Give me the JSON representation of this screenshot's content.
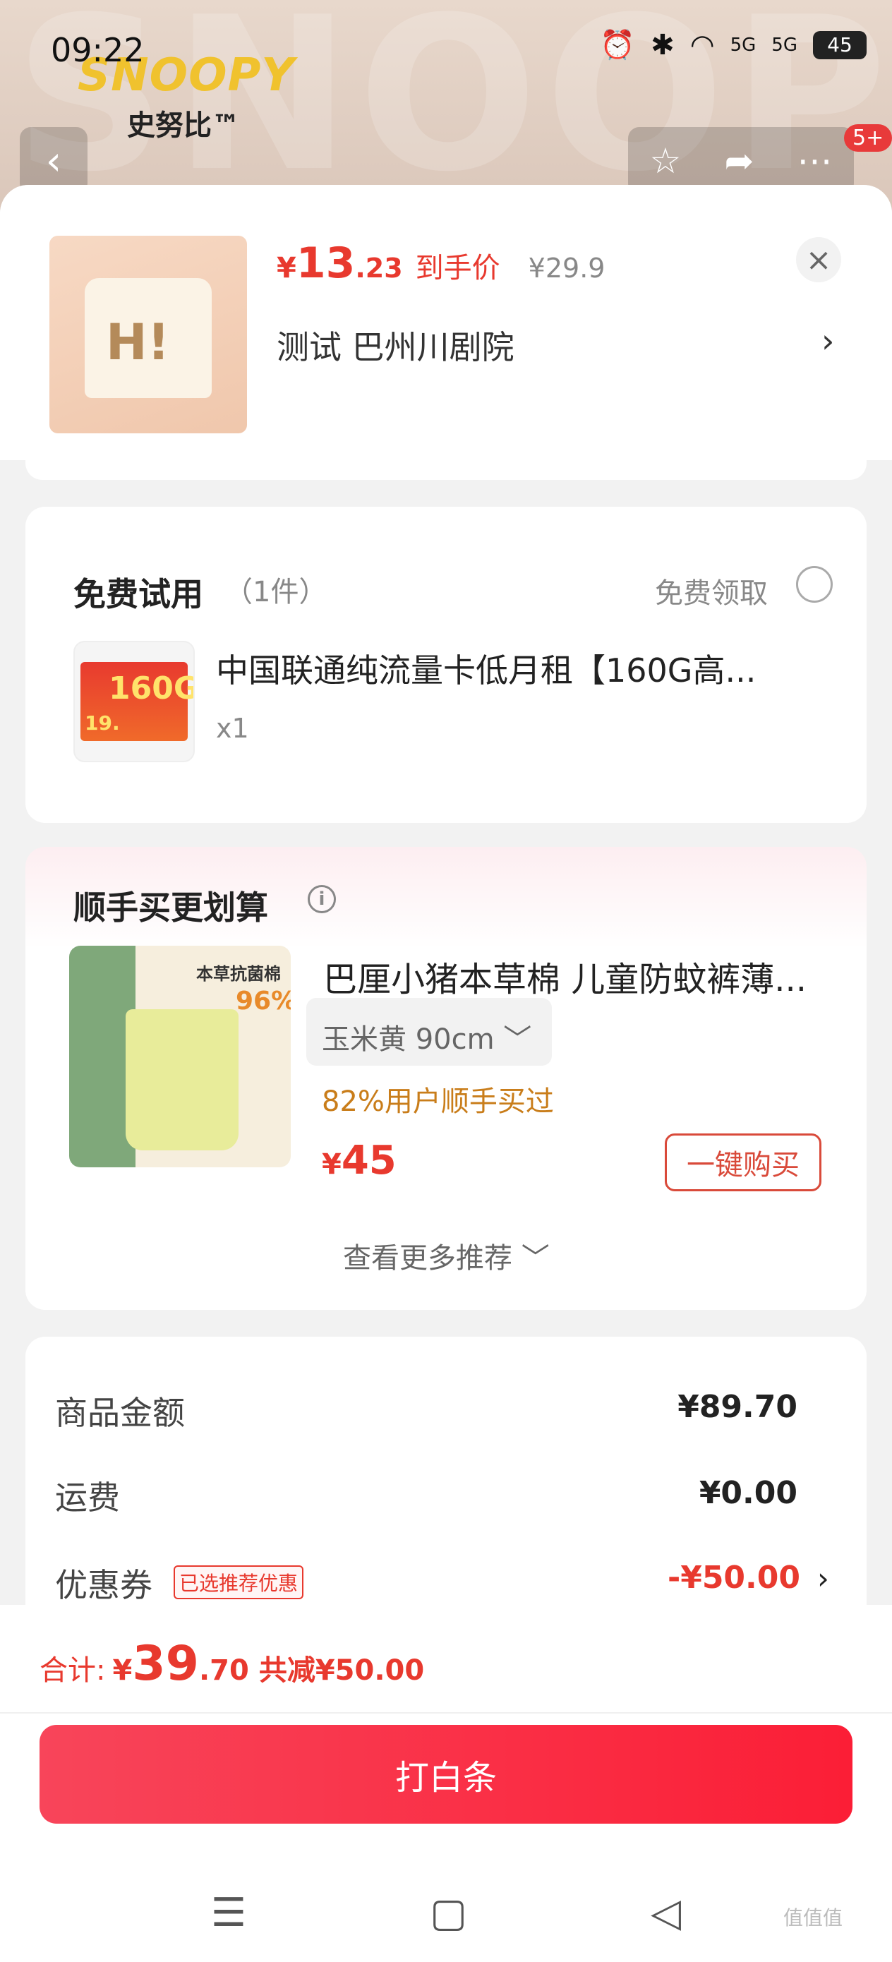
{
  "status_bar": {
    "time": "09:22",
    "battery": "45",
    "net1": "5G",
    "net2": "5G"
  },
  "background": {
    "brand_en": "SNOOPY",
    "brand_tm": "™",
    "brand_cn": "史努比™",
    "cart_badge": "5+"
  },
  "header": {
    "price_yen": "¥",
    "price_int": "13",
    "price_dec": ".23",
    "price_tag": "到手价",
    "orig_price": "¥29.9",
    "variant": "测试 巴州川剧院",
    "variant_arrow": "›",
    "close": "×"
  },
  "free_trial": {
    "title": "免费试用",
    "count": "（1件）",
    "claim": "免费领取",
    "item_name": "中国联通纯流量卡低月租【160G高...",
    "qty": "x1",
    "sim_big": "160G",
    "sim_price": "19."
  },
  "addon": {
    "title": "顺手买更划算",
    "info": "i",
    "item_name": "巴厘小猪本草棉 儿童防蚊裤薄...",
    "sku": "玉米黄   90cm ﹀",
    "stat": "82%用户顺手买过",
    "price_yen": "¥",
    "price": "45",
    "buy_label": "一键购买",
    "more": "查看更多推荐 ﹀",
    "img_label": "本草抗菌棉",
    "img_rate": "96%"
  },
  "summary": {
    "goods_label": "商品金额",
    "goods_value": "¥89.70",
    "ship_label": "运费",
    "ship_value": "¥0.00",
    "coupon_label": "优惠券",
    "coupon_tag": "已选推荐优惠",
    "coupon_value": "-¥50.00",
    "coupon_arrow": "›"
  },
  "footer": {
    "total_label": "合计:",
    "total_yen": "¥",
    "total_int": "39",
    "total_dec": ".70",
    "reduce": "共减¥50.00",
    "pay_label": "打白条",
    "watermark": "值值值"
  },
  "colors": {
    "accent": "#e8392e",
    "pay_button": "#fb1e36",
    "gold": "#c97d1a"
  }
}
